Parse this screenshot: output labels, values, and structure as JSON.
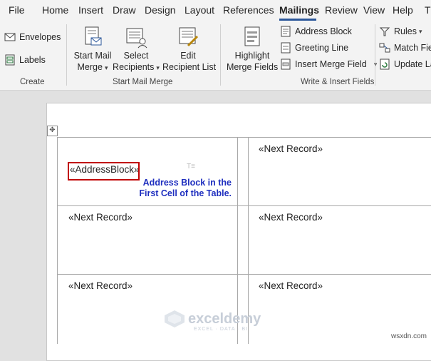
{
  "menu": {
    "tabs": [
      "File",
      "Home",
      "Insert",
      "Draw",
      "Design",
      "Layout",
      "References",
      "Mailings",
      "Review",
      "View",
      "Help",
      "T"
    ],
    "active_tab": "Mailings"
  },
  "ribbon": {
    "create": {
      "envelopes": "Envelopes",
      "labels": "Labels",
      "label": "Create"
    },
    "start_mail_merge": {
      "start_line1": "Start Mail",
      "start_line2": "Merge",
      "select_line1": "Select",
      "select_line2": "Recipients",
      "edit_line1": "Edit",
      "edit_line2": "Recipient List",
      "label": "Start Mail Merge"
    },
    "write_insert": {
      "highlight_line1": "Highlight",
      "highlight_line2": "Merge Fields",
      "address_block": "Address Block",
      "greeting_line": "Greeting Line",
      "insert_merge_field": "Insert Merge Field",
      "label": "Write & Insert Fields"
    },
    "rules_group": {
      "rules": "Rules",
      "match_fields": "Match Fie",
      "update_labels": "Update La"
    }
  },
  "document": {
    "address_block_field": "«AddressBlock»",
    "next_record": "«Next Record»",
    "annotation_line1": "Address Block in the",
    "annotation_line2": "First Cell of the Table."
  },
  "watermark": {
    "name": "exceldemy",
    "tagline": "EXCEL · DATA · BI"
  },
  "credit": "wsxdn.com"
}
